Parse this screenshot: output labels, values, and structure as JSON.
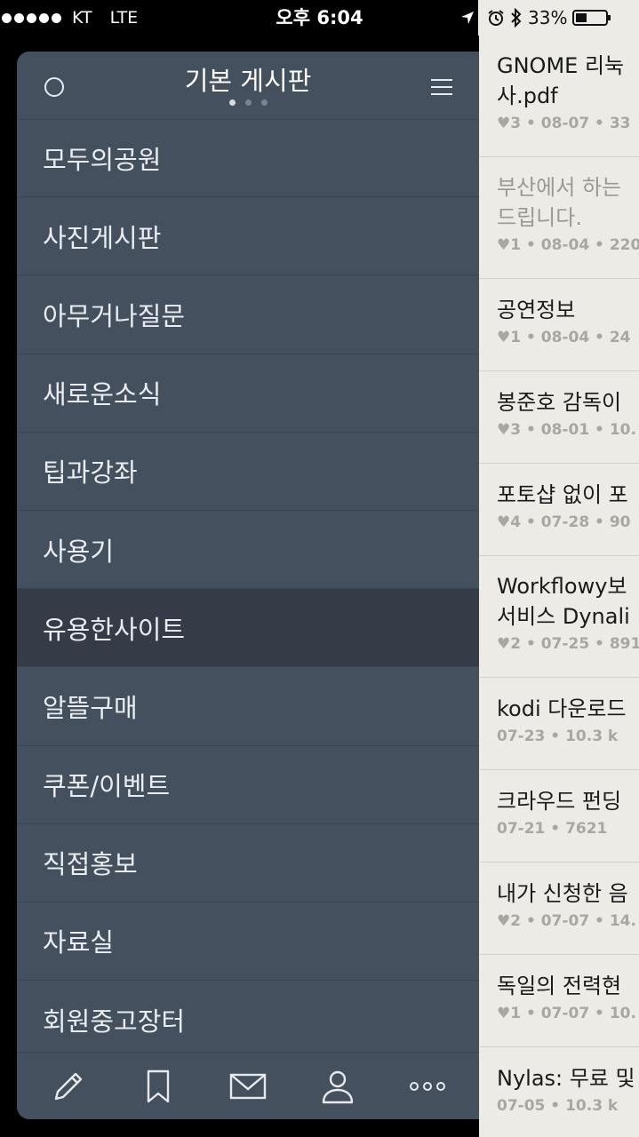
{
  "status": {
    "carrier": "KT",
    "network": "LTE",
    "time": "오후 6:04",
    "battery": "33%"
  },
  "drawer": {
    "title": "기본 게시판",
    "items": [
      {
        "label": "모두의공원"
      },
      {
        "label": "사진게시판"
      },
      {
        "label": "아무거나질문"
      },
      {
        "label": "새로운소식"
      },
      {
        "label": "팁과강좌"
      },
      {
        "label": "사용기"
      },
      {
        "label": "유용한사이트"
      },
      {
        "label": "알뜰구매"
      },
      {
        "label": "쿠폰/이벤트"
      },
      {
        "label": "직접홍보"
      },
      {
        "label": "자료실"
      },
      {
        "label": "회원중고장터"
      }
    ],
    "selected_index": 6
  },
  "posts": [
    {
      "title": "GNOME 리눅\n사.pdf",
      "meta": "♥3 • 08-07 • 33",
      "height": 137
    },
    {
      "title": "부산에서 하는\n드립니다.",
      "meta": "♥1 • 08-04 • 220",
      "height": 137,
      "dim": true
    },
    {
      "title": "공연정보",
      "meta": "♥1 • 08-04 • 24",
      "height": 104
    },
    {
      "title": "봉준호 감독이",
      "meta": "♥3 • 08-01 • 10.",
      "height": 104
    },
    {
      "title": "포토샵 없이 포",
      "meta": "♥4 • 07-28 • 90",
      "height": 104
    },
    {
      "title": "Workflowy보\n서비스 Dynali",
      "meta": "♥2 • 07-25 • 891",
      "height": 137
    },
    {
      "title": "kodi 다운로드",
      "meta": "07-23 • 10.3 k",
      "height": 104
    },
    {
      "title": "크라우드 펀딩",
      "meta": "07-21 • 7621",
      "height": 104
    },
    {
      "title": "내가 신청한 음",
      "meta": "♥2 • 07-07 • 14.",
      "height": 104
    },
    {
      "title": "독일의 전력현",
      "meta": "♥1 • 07-07 • 10.",
      "height": 104
    },
    {
      "title": "Nylas: 무료 및",
      "meta": "07-05 • 10.3 k",
      "height": 104
    }
  ]
}
